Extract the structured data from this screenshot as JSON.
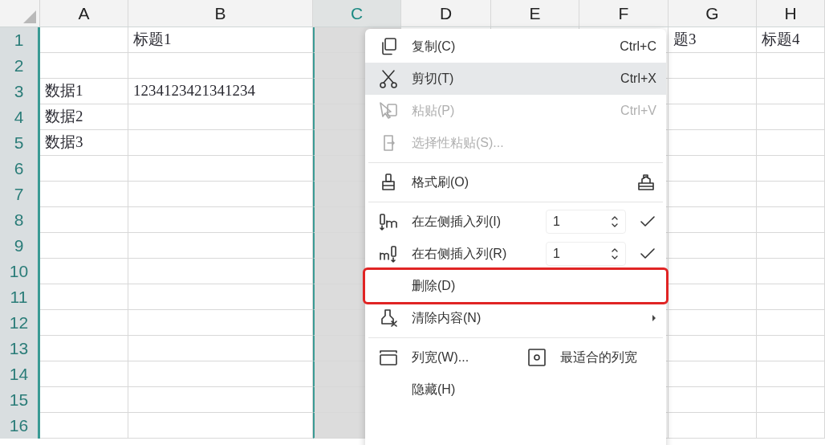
{
  "sheet": {
    "columns": [
      {
        "label": "A",
        "selected": false
      },
      {
        "label": "B",
        "selected": false
      },
      {
        "label": "C",
        "selected": true
      },
      {
        "label": "D",
        "selected": false
      },
      {
        "label": "E",
        "selected": false
      },
      {
        "label": "F",
        "selected": false
      },
      {
        "label": "G",
        "selected": false
      },
      {
        "label": "H",
        "selected": false
      }
    ],
    "rows": [
      {
        "label": "1",
        "cells": [
          null,
          "标题1",
          null,
          null,
          null,
          null,
          "题3",
          "标题4"
        ]
      },
      {
        "label": "2",
        "cells": [
          null,
          null,
          null,
          null,
          null,
          null,
          null,
          null
        ]
      },
      {
        "label": "3",
        "cells": [
          "数据1",
          "1234123421341234",
          null,
          null,
          null,
          null,
          null,
          null
        ]
      },
      {
        "label": "4",
        "cells": [
          "数据2",
          null,
          null,
          null,
          null,
          null,
          null,
          null
        ]
      },
      {
        "label": "5",
        "cells": [
          "数据3",
          null,
          null,
          null,
          null,
          null,
          null,
          null
        ]
      },
      {
        "label": "6",
        "cells": [
          null,
          null,
          null,
          null,
          null,
          null,
          null,
          null
        ]
      },
      {
        "label": "7",
        "cells": [
          null,
          null,
          null,
          null,
          null,
          null,
          null,
          null
        ]
      },
      {
        "label": "8",
        "cells": [
          null,
          null,
          null,
          null,
          null,
          null,
          null,
          null
        ]
      },
      {
        "label": "9",
        "cells": [
          null,
          null,
          null,
          null,
          null,
          null,
          null,
          null
        ]
      },
      {
        "label": "10",
        "cells": [
          null,
          null,
          null,
          null,
          null,
          null,
          null,
          null
        ]
      },
      {
        "label": "11",
        "cells": [
          null,
          null,
          null,
          null,
          null,
          null,
          null,
          null
        ]
      },
      {
        "label": "12",
        "cells": [
          null,
          null,
          null,
          null,
          null,
          null,
          null,
          null
        ]
      },
      {
        "label": "13",
        "cells": [
          null,
          null,
          null,
          null,
          null,
          null,
          null,
          null
        ]
      },
      {
        "label": "14",
        "cells": [
          null,
          null,
          null,
          null,
          null,
          null,
          null,
          null
        ]
      },
      {
        "label": "15",
        "cells": [
          null,
          null,
          null,
          null,
          null,
          null,
          null,
          null
        ]
      },
      {
        "label": "16",
        "cells": [
          null,
          null,
          null,
          null,
          null,
          null,
          null,
          null
        ]
      }
    ]
  },
  "context_menu": {
    "items": [
      {
        "kind": "item",
        "label": "复制(C)",
        "shortcut": "Ctrl+C",
        "disabled": false,
        "selected": false,
        "highlighted": false
      },
      {
        "kind": "item",
        "label": "剪切(T)",
        "shortcut": "Ctrl+X",
        "disabled": false,
        "selected": true,
        "highlighted": false
      },
      {
        "kind": "item",
        "label": "粘贴(P)",
        "shortcut": "Ctrl+V",
        "disabled": true,
        "selected": false,
        "highlighted": false
      },
      {
        "kind": "item",
        "label": "选择性粘贴(S)...",
        "disabled": true,
        "selected": false,
        "highlighted": false
      },
      {
        "kind": "separator"
      },
      {
        "kind": "item",
        "label": "格式刷(O)",
        "disabled": false,
        "selected": false,
        "highlighted": false
      },
      {
        "kind": "separator"
      },
      {
        "kind": "spin",
        "label": "在左侧插入列(I)",
        "value": "1",
        "disabled": false,
        "selected": false,
        "highlighted": false
      },
      {
        "kind": "spin",
        "label": "在右侧插入列(R)",
        "value": "1",
        "disabled": false,
        "selected": false,
        "highlighted": false
      },
      {
        "kind": "item",
        "label": "删除(D)",
        "disabled": false,
        "selected": false,
        "highlighted": true
      },
      {
        "kind": "submenu",
        "label": "清除内容(N)",
        "disabled": false,
        "selected": false,
        "highlighted": false
      },
      {
        "kind": "separator"
      },
      {
        "kind": "pair",
        "label": "列宽(W)...",
        "second_label": "最适合的列宽",
        "disabled": false,
        "selected": false,
        "highlighted": false
      },
      {
        "kind": "item",
        "label": "隐藏(H)",
        "disabled": false,
        "selected": false,
        "highlighted": false
      }
    ]
  }
}
